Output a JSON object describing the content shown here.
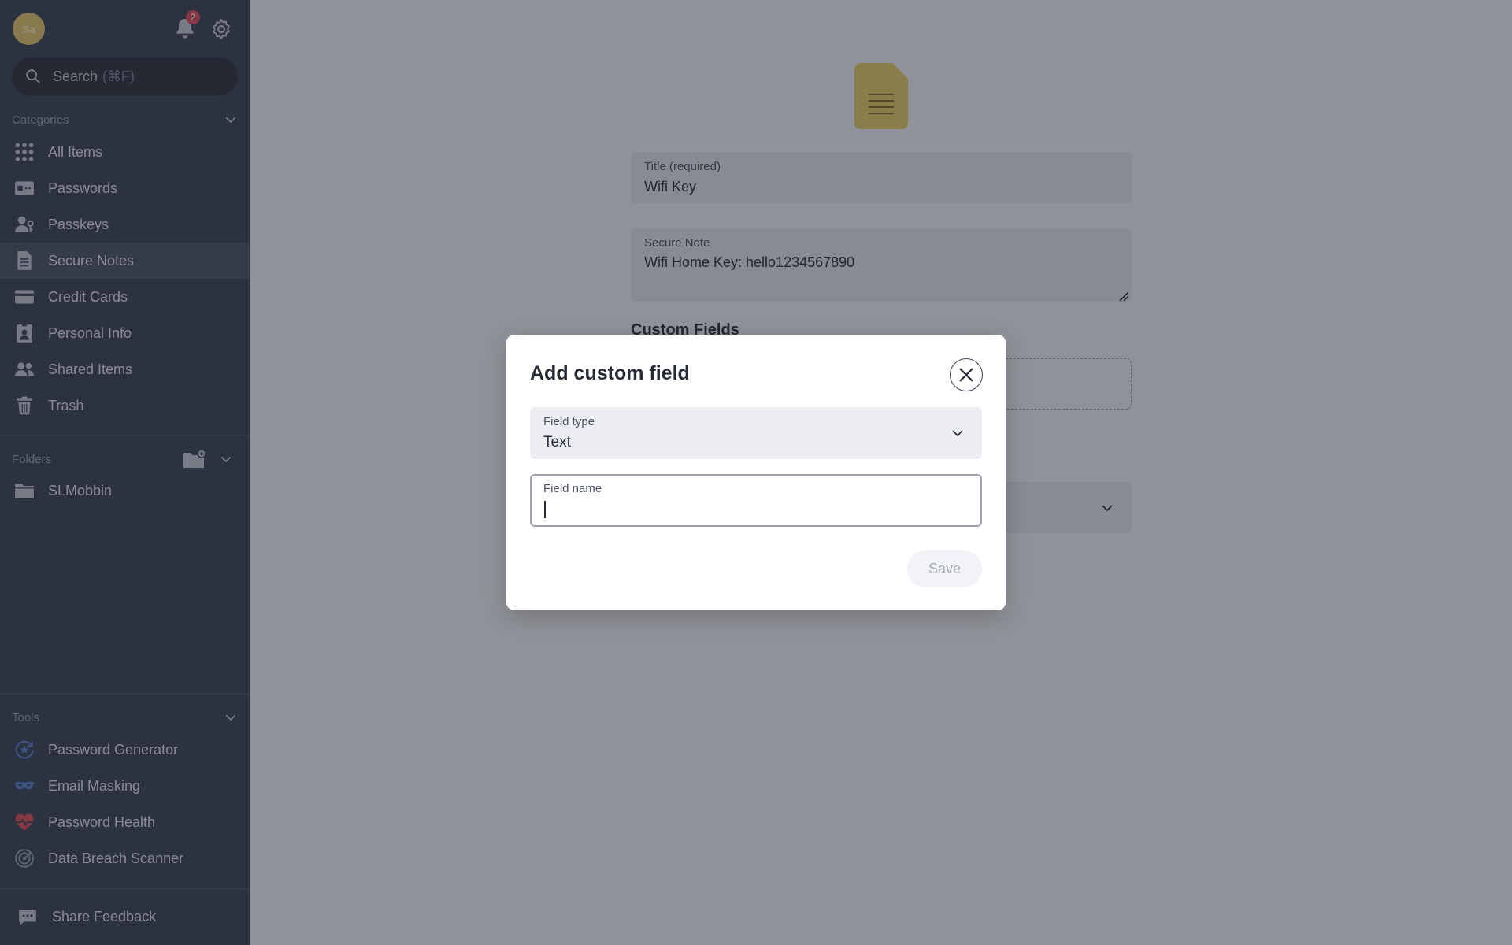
{
  "sidebar": {
    "avatar_initials": "Sa",
    "notification_count": "2",
    "search": {
      "placeholder": "Search",
      "shortcut": "(⌘F)"
    },
    "categories_label": "Categories",
    "categories": [
      {
        "label": "All Items",
        "icon": "grid-icon"
      },
      {
        "label": "Passwords",
        "icon": "password-card-icon"
      },
      {
        "label": "Passkeys",
        "icon": "passkey-user-icon"
      },
      {
        "label": "Secure Notes",
        "icon": "note-icon",
        "active": true
      },
      {
        "label": "Credit Cards",
        "icon": "credit-card-icon"
      },
      {
        "label": "Personal Info",
        "icon": "id-badge-icon"
      },
      {
        "label": "Shared Items",
        "icon": "people-icon"
      },
      {
        "label": "Trash",
        "icon": "trash-icon"
      }
    ],
    "folders_label": "Folders",
    "folders": [
      {
        "label": "SLMobbin",
        "icon": "folder-icon"
      }
    ],
    "tools_label": "Tools",
    "tools": [
      {
        "label": "Password Generator",
        "icon": "generator-icon"
      },
      {
        "label": "Email Masking",
        "icon": "mask-icon"
      },
      {
        "label": "Password Health",
        "icon": "heart-pulse-icon"
      },
      {
        "label": "Data Breach Scanner",
        "icon": "radar-icon"
      }
    ],
    "feedback_label": "Share Feedback"
  },
  "item": {
    "title_label": "Title (required)",
    "title_value": "Wifi Key",
    "note_label": "Secure Note",
    "note_value": "Wifi Home Key: hello1234567890",
    "custom_fields_label": "Custom Fields"
  },
  "modal": {
    "title": "Add custom field",
    "field_type_label": "Field type",
    "field_type_value": "Text",
    "field_name_label": "Field name",
    "field_name_value": "",
    "save_label": "Save"
  },
  "colors": {
    "sidebar_bg": "#3a4152",
    "accent_yellow": "#e5c46a",
    "badge_red": "#e04a59",
    "tool_blue": "#5b7fd6",
    "tool_red": "#e04a59"
  }
}
